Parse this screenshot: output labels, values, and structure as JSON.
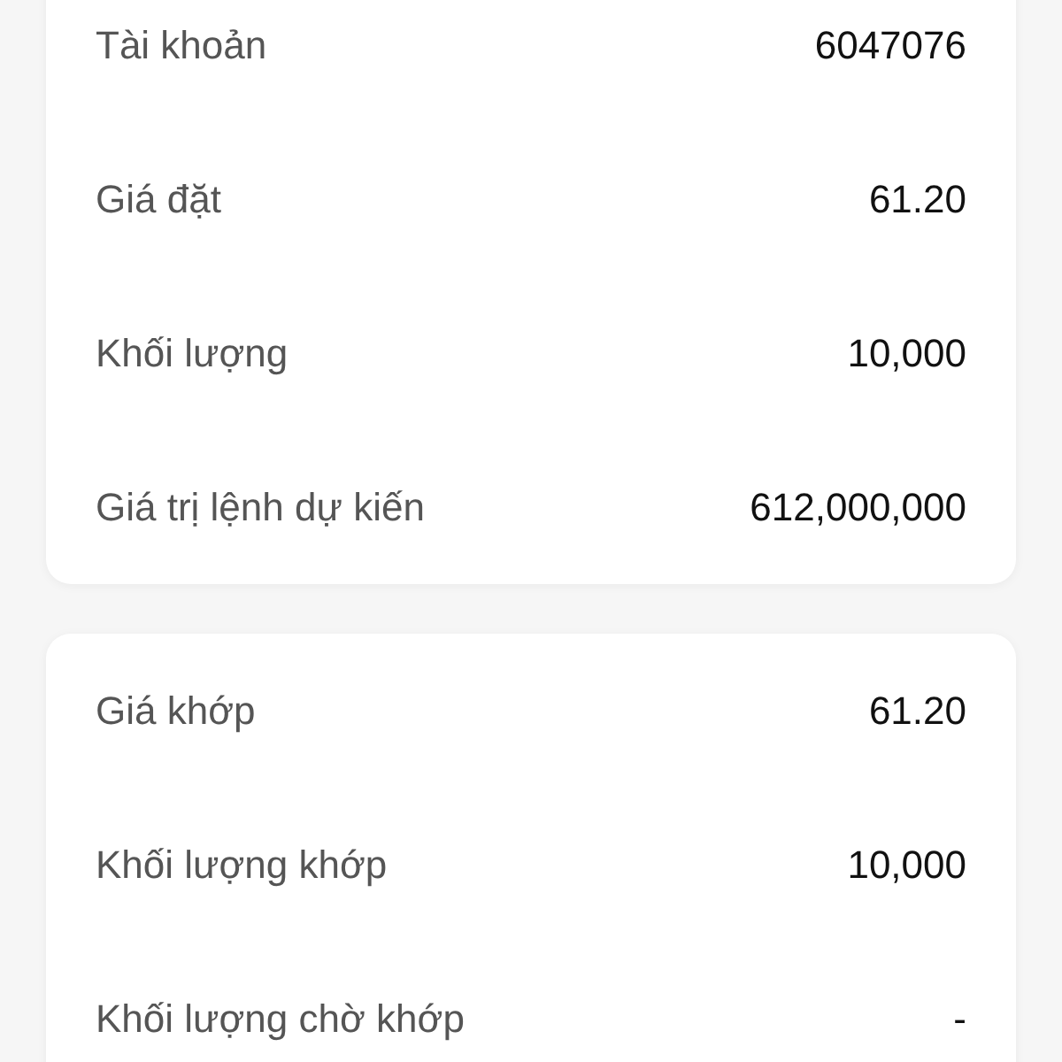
{
  "cards": [
    {
      "rows": [
        {
          "label": "Tài khoản",
          "value": "6047076"
        },
        {
          "label": "Giá đặt",
          "value": "61.20"
        },
        {
          "label": "Khối lượng",
          "value": "10,000"
        },
        {
          "label": "Giá trị lệnh dự kiến",
          "value": "612,000,000"
        }
      ]
    },
    {
      "rows": [
        {
          "label": "Giá khớp",
          "value": "61.20"
        },
        {
          "label": "Khối lượng khớp",
          "value": "10,000"
        },
        {
          "label": "Khối lượng chờ khớp",
          "value": "-"
        }
      ]
    }
  ]
}
